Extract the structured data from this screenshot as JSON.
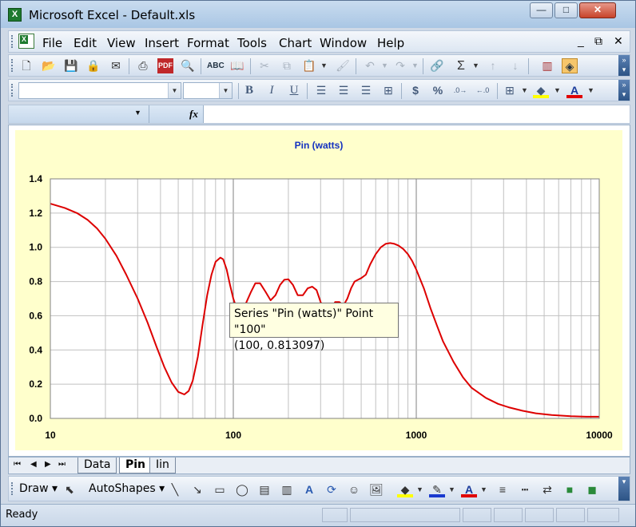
{
  "window": {
    "title": "Microsoft Excel - Default.xls",
    "minimize": "—",
    "maximize": "□",
    "close": "✕"
  },
  "menubar": {
    "items": [
      "File",
      "Edit",
      "View",
      "Insert",
      "Format",
      "Tools",
      "Chart",
      "Window",
      "Help"
    ],
    "doc_minimize": "_",
    "doc_restore": "⧉",
    "doc_close": "✕"
  },
  "formula_bar": {
    "name_box": "",
    "fx_label": "fx",
    "formula": ""
  },
  "format_toolbar": {
    "font_name": "",
    "font_size": "",
    "bold": "B",
    "italic": "I",
    "underline": "U",
    "currency": "$",
    "percent": "%"
  },
  "chart_data": {
    "type": "line",
    "title": "Pin (watts)",
    "xscale": "log",
    "xlim": [
      10,
      10000
    ],
    "ylim": [
      0,
      1.4
    ],
    "x_ticks": [
      "10",
      "100",
      "1000",
      "10000"
    ],
    "y_ticks": [
      "0.0",
      "0.2",
      "0.4",
      "0.6",
      "0.8",
      "1.0",
      "1.2",
      "1.4"
    ],
    "grid": true,
    "series": [
      {
        "name": "Pin (watts)",
        "color": "#dd0000",
        "x": [
          10,
          12,
          14,
          16,
          18,
          20,
          23,
          26,
          30,
          34,
          38,
          42,
          46,
          50,
          54,
          57,
          60,
          64,
          68,
          72,
          76,
          80,
          85,
          88,
          92,
          96,
          100,
          106,
          112,
          118,
          125,
          132,
          140,
          150,
          160,
          170,
          180,
          190,
          200,
          212,
          225,
          240,
          255,
          270,
          285,
          300,
          320,
          340,
          360,
          380,
          400,
          420,
          440,
          460,
          480,
          500,
          530,
          560,
          600,
          640,
          680,
          720,
          760,
          800,
          850,
          900,
          950,
          1000,
          1100,
          1200,
          1300,
          1400,
          1600,
          1800,
          2000,
          2400,
          2800,
          3200,
          3800,
          4500,
          5500,
          7000,
          8500,
          10000
        ],
        "values": [
          1.255,
          1.23,
          1.2,
          1.16,
          1.11,
          1.05,
          0.95,
          0.84,
          0.7,
          0.56,
          0.42,
          0.3,
          0.21,
          0.155,
          0.14,
          0.16,
          0.22,
          0.36,
          0.55,
          0.72,
          0.84,
          0.915,
          0.94,
          0.93,
          0.87,
          0.78,
          0.7,
          0.62,
          0.62,
          0.68,
          0.74,
          0.79,
          0.79,
          0.74,
          0.69,
          0.72,
          0.78,
          0.81,
          0.813,
          0.78,
          0.72,
          0.72,
          0.76,
          0.77,
          0.75,
          0.68,
          0.62,
          0.63,
          0.68,
          0.68,
          0.66,
          0.7,
          0.76,
          0.8,
          0.81,
          0.82,
          0.84,
          0.9,
          0.96,
          1.0,
          1.02,
          1.025,
          1.02,
          1.01,
          0.99,
          0.96,
          0.92,
          0.87,
          0.76,
          0.64,
          0.54,
          0.45,
          0.33,
          0.24,
          0.18,
          0.12,
          0.085,
          0.065,
          0.045,
          0.03,
          0.02,
          0.013,
          0.01,
          0.01
        ]
      }
    ]
  },
  "tooltip": {
    "line1": "Series \"Pin (watts)\" Point \"100\"",
    "line2": "(100, 0.813097)"
  },
  "sheet_tabs": {
    "items": [
      "Data",
      "Pin",
      "Iin"
    ],
    "active": "Pin"
  },
  "draw_toolbar": {
    "draw": "Draw",
    "autoshapes": "AutoShapes"
  },
  "status": {
    "text": "Ready"
  }
}
